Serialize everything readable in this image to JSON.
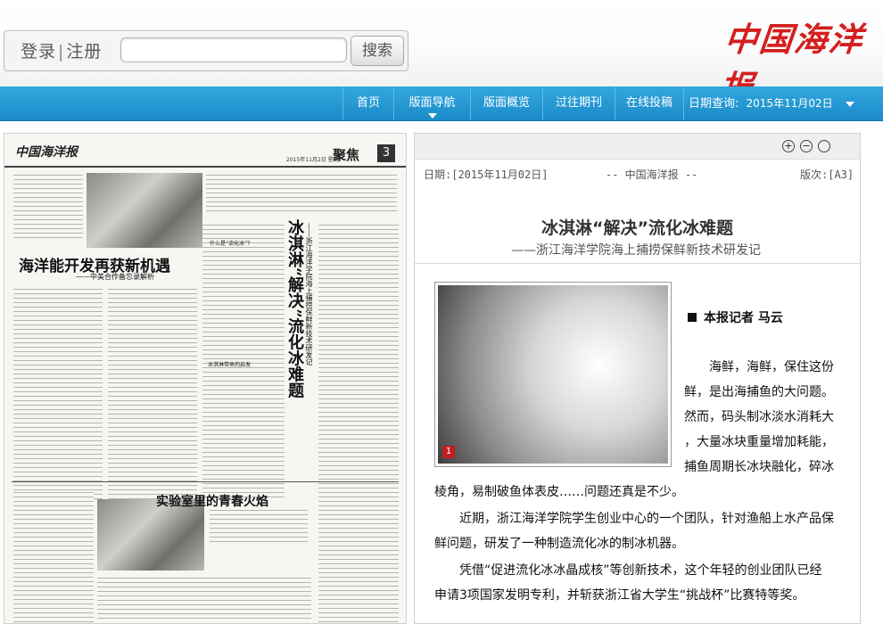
{
  "header": {
    "login_label": "登录",
    "register_label": "注册",
    "search_placeholder": "",
    "search_button": "搜索",
    "logo_text": "中国海洋报"
  },
  "nav": {
    "items": [
      {
        "label": "首页"
      },
      {
        "label": "版面导航"
      },
      {
        "label": "版面概览"
      },
      {
        "label": "过往期刊"
      },
      {
        "label": "在线投稿"
      }
    ],
    "date_query_label": "日期查询:",
    "date_query_value": "2015年11月02日"
  },
  "scan": {
    "masthead": "中国海洋报",
    "date": "2015年11月2日 星期一",
    "section": "聚焦",
    "page_number": "3",
    "headline_main": "海洋能开发再获新机遇",
    "headline_sub": "——中美合作备忘录解析",
    "vertical_title": "冰淇淋“解决”流化冰难题",
    "vertical_subtitle": "——浙江海洋学院海上捕捞保鲜新技术研发记",
    "bottom_headline": "实验室里的青春火焰",
    "inner_head_1": "什么是“流化冰”?",
    "inner_head_2": "冰淇淋带来的启发"
  },
  "article": {
    "toolbar_icons": [
      "zoom-in-icon",
      "zoom-out-icon",
      "reset-icon"
    ],
    "meta_date": "日期:[2015年11月02日]",
    "meta_paper": "-- 中国海洋报 --",
    "meta_page": "版次:[A3]",
    "title": "冰淇淋“解决”流化冰难题",
    "subtitle": "——浙江海洋学院海上捕捞保鲜新技术研发记",
    "photo_number": "1",
    "reporter": "本报记者 马云",
    "para1_lines": [
      "海鲜，海鲜，保住这份",
      "鲜，是出海捕鱼的大问题。",
      "然而，码头制冰淡水消耗大",
      "，大量冰块重量增加耗能，",
      "捕鱼周期长冰块融化，碎冰",
      "棱角，易制破鱼体表皮……问题还真是不少。"
    ],
    "para2_lines": [
      "近期，浙江海洋学院学生创业中心的一个团队，针对渔船上水产品保",
      "鲜问题，研发了一种制造流化冰的制冰机器。"
    ],
    "para3_lines": [
      "凭借“促进流化冰冰晶成核”等创新技术，这个年轻的创业团队已经",
      "申请3项国家发明专利，并斩获浙江省大学生“挑战杯”比赛特等奖。"
    ]
  }
}
